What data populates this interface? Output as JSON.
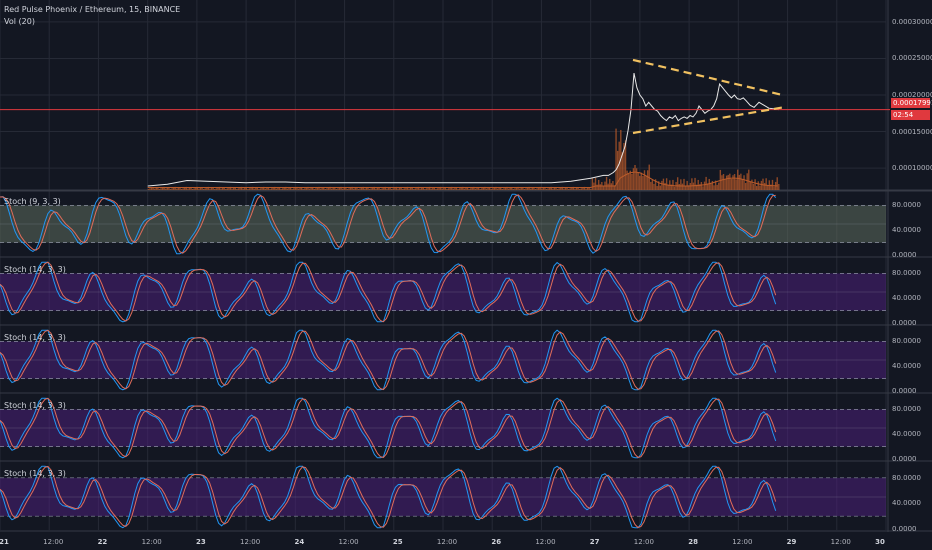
{
  "header": {
    "title": "Red Pulse Phoenix / Ethereum, 15, BINANCE",
    "volume_label": "Vol (20)"
  },
  "price_tag": {
    "price": "0.00017991",
    "countdown": "02:54"
  },
  "colors": {
    "background": "#131722",
    "grid": "#262a36",
    "price_line": "#e8e8e8",
    "last_price_line": "#e0393e",
    "triangle": "#f0c060",
    "k_line": "#2196f3",
    "d_line": "#e06c5a",
    "stoch_band_1": "#5c6b5d",
    "stoch_band_rest": "#4a1f78",
    "volume": "#b85a2a"
  },
  "chart_data": [
    {
      "type": "line",
      "name": "price",
      "ylim": [
        7e-05,
        0.00033
      ],
      "ytick_labels": [
        "0.00030000",
        "0.00025000",
        "0.00020000",
        "0.00015000",
        "0.00010000"
      ],
      "ytick_values": [
        0.0003,
        0.00025,
        0.0002,
        0.00015,
        0.0001
      ],
      "last_price": 0.00017991,
      "x": [
        0,
        5,
        10,
        15,
        17,
        19,
        21,
        23,
        25,
        27,
        29,
        31,
        33,
        35,
        38,
        41,
        44,
        47,
        50,
        53,
        56,
        58,
        60,
        61.3,
        61.8,
        62.3,
        62.6,
        62.9,
        63.2,
        63.5,
        63.8,
        64.1,
        64.4,
        64.7,
        65,
        65.3,
        65.6,
        65.9,
        66.2,
        66.5,
        66.8,
        67.1,
        67.4,
        67.7,
        68,
        68.3,
        68.6,
        68.9,
        69.2,
        69.5,
        69.8,
        70.1,
        70.4,
        70.7,
        71,
        71.3,
        71.6,
        71.9,
        72.2,
        72.5,
        72.8,
        73.1,
        73.4,
        73.7,
        74,
        74.3,
        74.6,
        74.9,
        75.2,
        75.5,
        75.8,
        76.2,
        76.6,
        77.1,
        77.6,
        78.1,
        78.6,
        79.1
      ],
      "y": [
        null,
        null,
        null,
        7.55e-05,
        7.8e-05,
        8.3e-05,
        8.2e-05,
        8.1e-05,
        8e-05,
        8.1e-05,
        8.1e-05,
        8e-05,
        8e-05,
        8e-05,
        8e-05,
        8e-05,
        8e-05,
        8e-05,
        8e-05,
        8e-05,
        8e-05,
        8.2e-05,
        8.6e-05,
        9e-05,
        9e-05,
        9.4e-05,
        9.8e-05,
        0.000106,
        0.000118,
        0.00013,
        0.000152,
        0.00018,
        0.00023,
        0.00021,
        0.0002,
        0.000195,
        0.000185,
        0.00019,
        0.000185,
        0.00018,
        0.000178,
        0.000172,
        0.000168,
        0.000165,
        0.00017,
        0.000168,
        0.000172,
        0.000165,
        0.000168,
        0.00017,
        0.000168,
        0.000172,
        0.00017,
        0.000175,
        0.000185,
        0.00018,
        0.000175,
        0.000178,
        0.00018,
        0.000185,
        0.000195,
        0.000215,
        0.00021,
        0.000205,
        0.0002,
        0.000196,
        0.0002,
        0.000195,
        0.000194,
        0.000196,
        0.000192,
        0.000186,
        0.000183,
        0.00019,
        0.000186,
        0.000182,
        0.000181,
        0.00018
      ]
    }
  ],
  "stoch_panels": [
    {
      "label": "Stoch (9, 3, 3)",
      "ytick_labels": [
        "80.0000",
        "40.0000",
        "0.0000"
      ],
      "ylim": [
        0,
        100
      ],
      "band": [
        20,
        80
      ]
    },
    {
      "label": "Stoch (14, 3, 3)",
      "ytick_labels": [
        "80.0000",
        "40.0000",
        "0.0000"
      ],
      "ylim": [
        0,
        100
      ],
      "band": [
        20,
        80
      ]
    },
    {
      "label": "Stoch (14, 3, 3)",
      "ytick_labels": [
        "80.0000",
        "40.0000",
        "0.0000"
      ],
      "ylim": [
        0,
        100
      ],
      "band": [
        20,
        80
      ]
    },
    {
      "label": "Stoch (14, 3, 3)",
      "ytick_labels": [
        "80.0000",
        "40.0000",
        "0.0000"
      ],
      "ylim": [
        0,
        100
      ],
      "band": [
        20,
        80
      ]
    },
    {
      "label": "Stoch (14, 3, 3)",
      "ytick_labels": [
        "80.0000",
        "40.0000",
        "0.0000"
      ],
      "ylim": [
        0,
        100
      ],
      "band": [
        20,
        80
      ]
    }
  ],
  "x_axis": {
    "range": [
      0,
      90
    ],
    "labels": [
      {
        "text": "21",
        "x": 0,
        "day": true
      },
      {
        "text": "12:00",
        "x": 5
      },
      {
        "text": "22",
        "x": 10,
        "day": true
      },
      {
        "text": "12:00",
        "x": 15
      },
      {
        "text": "23",
        "x": 20,
        "day": true
      },
      {
        "text": "12:00",
        "x": 25
      },
      {
        "text": "24",
        "x": 30,
        "day": true
      },
      {
        "text": "12:00",
        "x": 35
      },
      {
        "text": "25",
        "x": 40,
        "day": true
      },
      {
        "text": "12:00",
        "x": 45
      },
      {
        "text": "26",
        "x": 50,
        "day": true
      },
      {
        "text": "12:00",
        "x": 55
      },
      {
        "text": "27",
        "x": 60,
        "day": true
      },
      {
        "text": "12:00",
        "x": 65
      },
      {
        "text": "28",
        "x": 70,
        "day": true
      },
      {
        "text": "12:00",
        "x": 75
      },
      {
        "text": "29",
        "x": 80,
        "day": true
      },
      {
        "text": "12:00",
        "x": 85
      },
      {
        "text": "30",
        "x": 90,
        "day": true
      }
    ]
  }
}
